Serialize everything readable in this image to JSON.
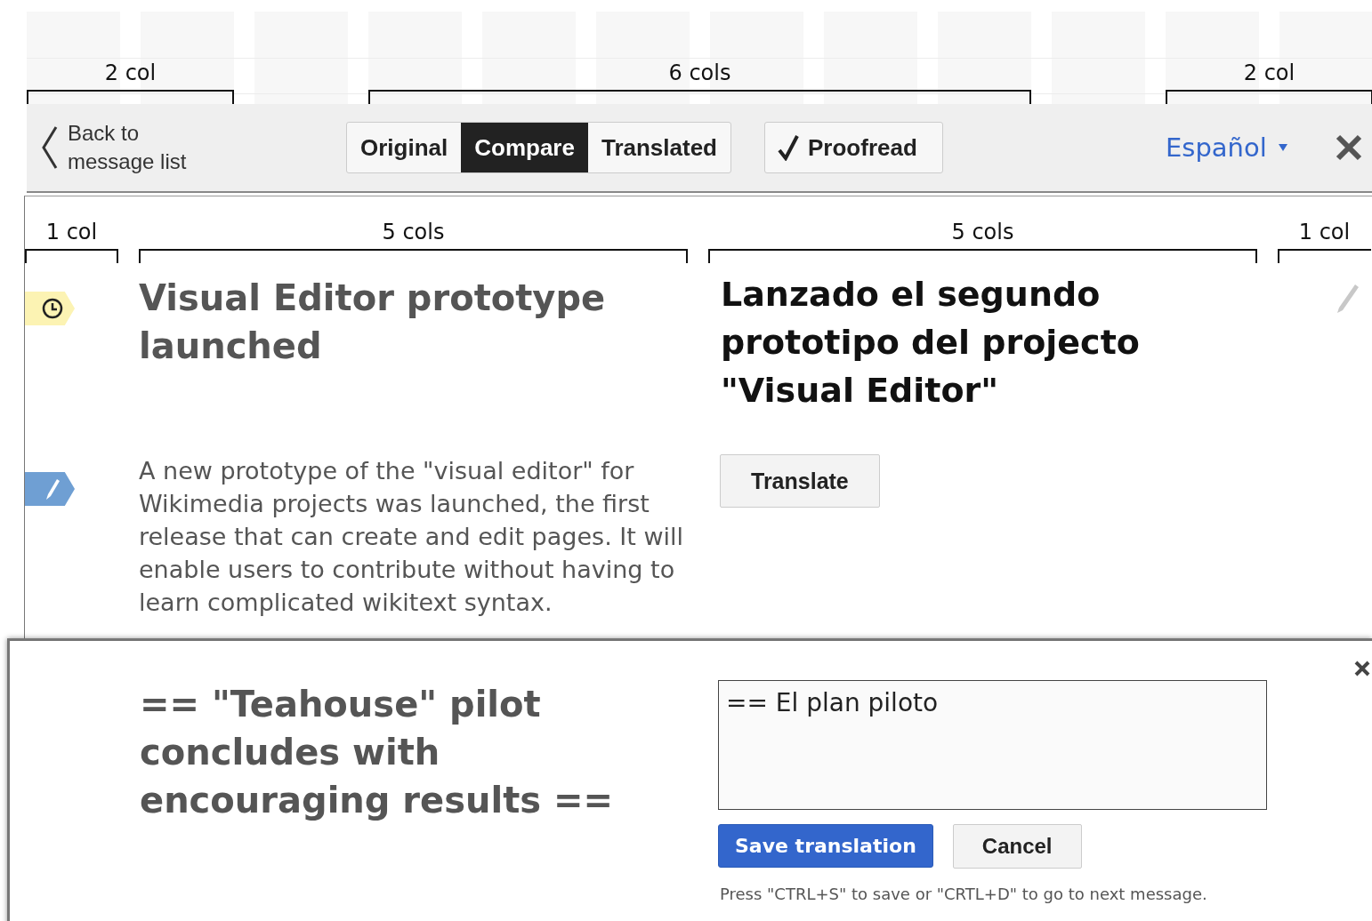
{
  "column_guides_top": [
    {
      "label": "2 col"
    },
    {
      "label": "6 cols"
    },
    {
      "label": "2 col"
    }
  ],
  "toolbar": {
    "back_link": "Back to message list",
    "view_tabs": [
      {
        "label": "Original",
        "selected": false
      },
      {
        "label": "Compare",
        "selected": true
      },
      {
        "label": "Translated",
        "selected": false
      }
    ],
    "proofread_button": "Proofread",
    "language": "Español"
  },
  "column_guides_content": [
    {
      "label": "1 col"
    },
    {
      "label": "5 cols"
    },
    {
      "label": "5 cols"
    },
    {
      "label": "1 col"
    }
  ],
  "messages": [
    {
      "status": {
        "kind": "clock",
        "color": "#fcf3b3"
      },
      "kind": "heading",
      "source": "Visual Editor prototype launched",
      "translation": {
        "kind": "text",
        "text": "Lanzado el segundo prototipo del projecto \"Visual Editor\""
      },
      "editable": true
    },
    {
      "status": {
        "kind": "pencil",
        "color": "#6f9fd3"
      },
      "kind": "paragraph",
      "source": "A new prototype of the \"visual editor\" for Wikimedia projects was launched, the first release that can create and edit pages. It will enable users to contribute without having to learn complicated wikitext syntax.",
      "translation": {
        "kind": "button",
        "text": "Translate"
      },
      "editable": false
    }
  ],
  "editor": {
    "source": "== \"Teahouse\" pilot concludes with encouraging results ==",
    "value": "== El plan piloto",
    "save_button": "Save translation",
    "cancel_button": "Cancel",
    "hint": "Press \"CTRL+S\" to save or \"CRTL+D\" to go to next message."
  }
}
